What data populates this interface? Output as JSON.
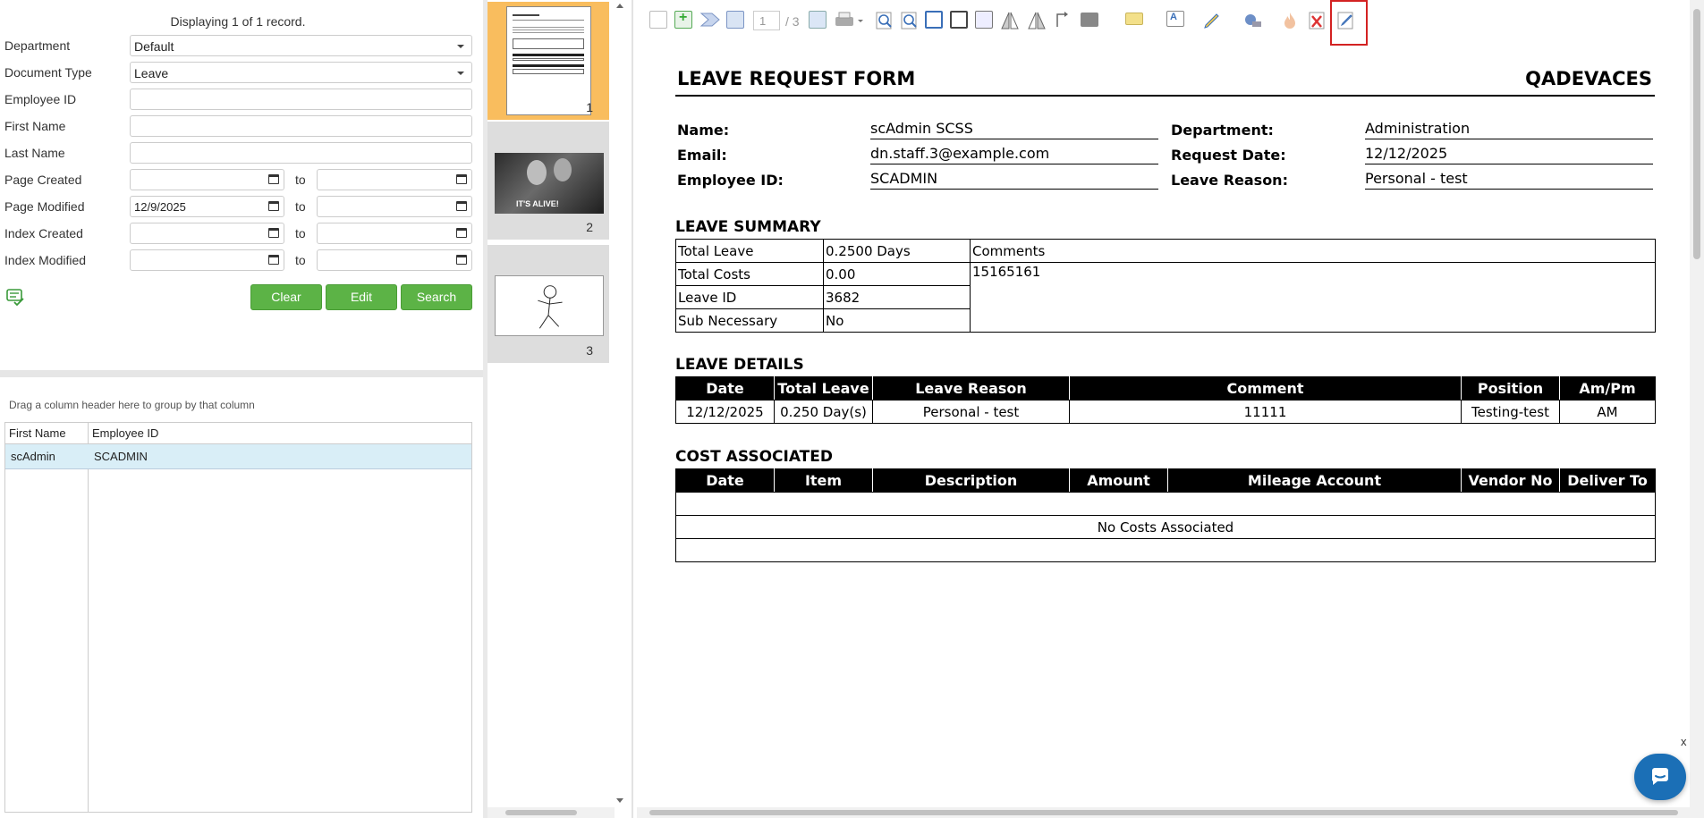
{
  "search": {
    "record_status": "Displaying 1 of 1 record.",
    "fields": {
      "department": {
        "label": "Department",
        "value": "Default"
      },
      "document_type": {
        "label": "Document Type",
        "value": "Leave"
      },
      "employee_id": {
        "label": "Employee ID",
        "value": ""
      },
      "first_name": {
        "label": "First Name",
        "value": ""
      },
      "last_name": {
        "label": "Last Name",
        "value": ""
      },
      "page_created": {
        "label": "Page Created",
        "from": "",
        "to": ""
      },
      "page_modified": {
        "label": "Page Modified",
        "from": "12/9/2025",
        "to": ""
      },
      "index_created": {
        "label": "Index Created",
        "from": "",
        "to": ""
      },
      "index_modified": {
        "label": "Index Modified",
        "from": "",
        "to": ""
      }
    },
    "to_label": "to",
    "buttons": {
      "clear": "Clear",
      "edit": "Edit",
      "search": "Search"
    }
  },
  "grid": {
    "group_hint": "Drag a column header here to group by that column",
    "columns": [
      "First Name",
      "Employee ID"
    ],
    "rows": [
      [
        "scAdmin",
        "SCADMIN"
      ]
    ]
  },
  "thumbnails": [
    {
      "page": "1",
      "selected": true
    },
    {
      "page": "2",
      "caption": "IT'S ALIVE!"
    },
    {
      "page": "3"
    }
  ],
  "toolbar": {
    "current_page": "1",
    "total_pages": "/ 3",
    "icons": [
      "new-page-icon",
      "add-page-icon",
      "forward-icon",
      "back-icon",
      "export-icon",
      "print-icon",
      "zoom-in-icon",
      "zoom-out-icon",
      "fit-width-icon",
      "fit-page-icon",
      "actual-size-icon",
      "flip-horizontal-icon",
      "flip-vertical-icon",
      "rotate-icon",
      "redact-icon",
      "highlight-icon",
      "text-icon",
      "pen-icon",
      "stamp-icon",
      "burn-icon",
      "delete-icon",
      "edit-annotation-icon"
    ]
  },
  "document": {
    "title": "LEAVE REQUEST FORM",
    "company": "QADEVACES",
    "info": {
      "name_label": "Name:",
      "name": "scAdmin SCSS",
      "email_label": "Email:",
      "email": "dn.staff.3@example.com",
      "employee_id_label": "Employee ID:",
      "employee_id": "SCADMIN",
      "department_label": "Department:",
      "department": "Administration",
      "request_date_label": "Request Date:",
      "request_date": "12/12/2025",
      "leave_reason_label": "Leave Reason:",
      "leave_reason": "Personal - test"
    },
    "summary": {
      "heading": "LEAVE SUMMARY",
      "total_leave_label": "Total Leave",
      "total_leave": "0.2500 Days",
      "total_costs_label": "Total Costs",
      "total_costs": "0.00",
      "leave_id_label": "Leave ID",
      "leave_id": "3682",
      "sub_necessary_label": "Sub Necessary",
      "sub_necessary": "No",
      "comments_label": "Comments",
      "comments": "15165161"
    },
    "details": {
      "heading": "LEAVE DETAILS",
      "columns": [
        "Date",
        "Total Leave",
        "Leave Reason",
        "Comment",
        "Position",
        "Am/Pm"
      ],
      "row": [
        "12/12/2025",
        "0.250 Day(s)",
        "Personal - test",
        "11111",
        "Testing-test",
        "AM"
      ]
    },
    "costs": {
      "heading": "COST ASSOCIATED",
      "columns": [
        "Date",
        "Item",
        "Description",
        "Amount",
        "Mileage Account",
        "Vendor No",
        "Deliver To"
      ],
      "empty_message": "No Costs Associated"
    }
  },
  "chat": {
    "close_label": "x"
  },
  "colors": {
    "accent_green": "#5cb346",
    "selected_thumb": "#f9bd5e",
    "highlight_red": "#d32222",
    "chat_blue": "#1b6fb6"
  }
}
